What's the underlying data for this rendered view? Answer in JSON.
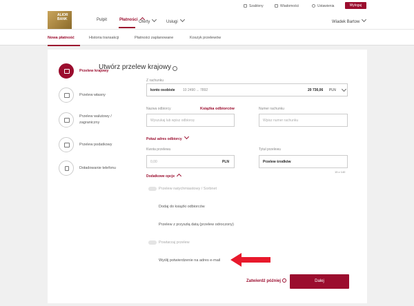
{
  "header": {
    "logo_text": "ALIOR\nBANK",
    "nav": [
      "Pulpit",
      "Płatności",
      "Oferty",
      "Usługi"
    ],
    "util": [
      "Szablony",
      "Wiadomości",
      "Ustawienia"
    ],
    "logout": "Wyloguj",
    "user": "Wiadek Bartow"
  },
  "tabs": [
    "Nowa płatność",
    "Historia transakcji",
    "Płatności zaplanowane",
    "Koszyk przelewów"
  ],
  "sidebar": [
    {
      "label": "Przelew krajowy"
    },
    {
      "label": "Przelew własny"
    },
    {
      "label": "Przelew walutowy / zagraniczny"
    },
    {
      "label": "Przelew podatkowy"
    },
    {
      "label": "Doładowanie telefonu"
    }
  ],
  "form": {
    "title": "Utwórz przelew krajowy",
    "from_label": "Z rachunku",
    "account_name": "konto osobiste",
    "account_number": "10 2490 ... 7892",
    "balance": "20 730,06",
    "currency": "PLN",
    "recipient_label": "Nazwa odbiorcy",
    "address_book": "Książka odbiorców",
    "recipient_placeholder": "Wyszukaj lub wpisz odbiorcę",
    "account_no_label": "Numer rachunku",
    "account_no_placeholder": "Wpisz numer rachunku",
    "show_address": "Pokaż adres odbiorcy",
    "amount_label": "Kwota przelewu",
    "amount_placeholder": "0,00",
    "amount_currency": "PLN",
    "title_label": "Tytuł przelewu",
    "title_value": "Przelew środków",
    "char_count": "15 z 140",
    "extra_options": "Dodatkowe opcje",
    "options": [
      "Przelew natychmiastowy / Sorbnet",
      "Dodaj do książki odbiorców",
      "Przelew z przyszłą datą (przelew odroczony)",
      "Powtarzaj przelew",
      "Wyślij potwierdzenie na adres e-mail"
    ],
    "confirm_later": "Zatwierdź później",
    "next": "Dalej"
  },
  "colors": {
    "accent": "#9b0d2e",
    "arrow": "#e8192c"
  }
}
